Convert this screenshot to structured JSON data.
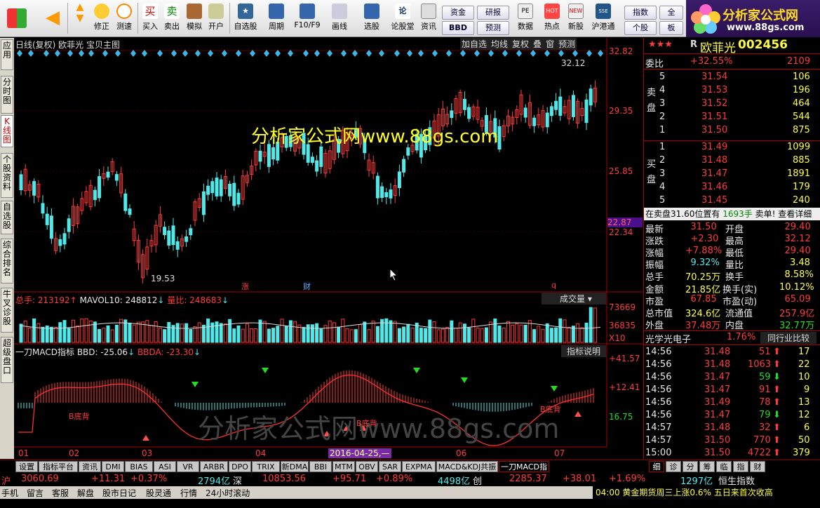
{
  "toolbar": {
    "buttons": [
      "修正",
      "测速",
      "买入",
      "卖出",
      "模拟",
      "开户",
      "自选股",
      "周期",
      "F10/F9",
      "画线",
      "选股",
      "论股堂",
      "资讯",
      "数据",
      "热点",
      "新股",
      "沪港通"
    ],
    "grid_buttons": [
      "资金",
      "研报",
      "指数",
      "全",
      "BBD",
      "预测",
      "个股",
      "板"
    ],
    "logo_main": "分析家公式网",
    "logo_url": "www.88gs.com"
  },
  "leftnav": [
    "应用",
    "分时图",
    "K线图",
    "个股资料",
    "自选股",
    "综合排名",
    "牛叉诊股",
    "超级盘口"
  ],
  "chart": {
    "header": "日线(复权) 欧菲光 宝贝主图",
    "header_btns": [
      "加自选",
      "均线",
      "复权",
      "叠",
      "窗",
      "预测"
    ],
    "watermark_top": "分析家公式网www.88gs.com",
    "watermark_bottom": "分析家公式网www.88gs.com",
    "price_axis": [
      "32.82",
      "29.35",
      "25.85",
      "22.34"
    ],
    "current_price_tag": "22.87",
    "high_label": "32.12",
    "low_label": "19.53",
    "markers": [
      "涨",
      "财",
      "q"
    ],
    "vol_header": {
      "total": "总手: 213192",
      "mavol": "MAVOL10: 248812",
      "ratio": "量比: 248683"
    },
    "vol_select": "成交量",
    "vol_axis": [
      "73669",
      "36835",
      "X10"
    ],
    "macd_header": {
      "name": "一刀MACD指标",
      "bbd": "BBD: -25.06",
      "bbda": "BBDA: -23.30"
    },
    "macd_btn": "指标说明",
    "macd_axis": [
      "+41.57",
      "+12.41",
      "16.75"
    ],
    "macd_labels": [
      "B底背",
      "B底背",
      "B底背"
    ],
    "date_axis": [
      "01",
      "02",
      "03",
      "04",
      "06",
      "07"
    ],
    "date_cursor": "2016-04-25,—"
  },
  "stock": {
    "stars": "★★★",
    "flag": "R",
    "name": "欧菲光",
    "code": "002456",
    "wei_label": "委比",
    "wei_pct": "+32.55%",
    "wei_val": "2109",
    "sell_label": "卖盘",
    "buy_label": "买盘",
    "sells": [
      {
        "n": "5",
        "p": "31.54",
        "v": "106"
      },
      {
        "n": "4",
        "p": "31.53",
        "v": "196"
      },
      {
        "n": "3",
        "p": "31.52",
        "v": "464"
      },
      {
        "n": "2",
        "p": "31.51",
        "v": "544"
      },
      {
        "n": "1",
        "p": "31.50",
        "v": "875"
      }
    ],
    "buys": [
      {
        "n": "1",
        "p": "31.49",
        "v": "1099"
      },
      {
        "n": "2",
        "p": "31.48",
        "v": "885"
      },
      {
        "n": "3",
        "p": "31.47",
        "v": "1891"
      },
      {
        "n": "4",
        "p": "31.46",
        "v": "179"
      },
      {
        "n": "5",
        "p": "31.45",
        "v": "240"
      }
    ],
    "notice_a": "在卖盘31.60位置有",
    "notice_b": "1693手",
    "notice_c": "卖单! 查看详细",
    "quotes": [
      [
        "最新",
        "31.50",
        "开盘",
        "29.40"
      ],
      [
        "涨跌",
        "+2.30",
        "最高",
        "32.12"
      ],
      [
        "涨幅",
        "+7.88%",
        "最低",
        "29.40"
      ],
      [
        "振幅",
        "9.32%",
        "量比",
        "3.48"
      ],
      [
        "总手",
        "70.25万",
        "换手",
        "8.58%"
      ],
      [
        "金额",
        "21.85亿",
        "换手(实)",
        "10.12%"
      ],
      [
        "市盈",
        "67.85",
        "市盈(动)",
        "65.09"
      ],
      [
        "总市值",
        "324.6亿",
        "流通值",
        "257.9亿"
      ],
      [
        "外盘",
        "37.48万",
        "内盘",
        "32.77万"
      ]
    ],
    "sector": "光学光电子",
    "sector_pct": "1.76%",
    "sector_btn": "同行业比较",
    "ticks": [
      [
        "14:56",
        "31.48",
        "51",
        "17"
      ],
      [
        "14:56",
        "31.48",
        "1063",
        "22"
      ],
      [
        "14:56",
        "31.47",
        "59",
        "10"
      ],
      [
        "14:56",
        "31.47",
        "91",
        "9"
      ],
      [
        "14:56",
        "31.49",
        "78",
        "13"
      ],
      [
        "14:56",
        "31.47",
        "79",
        "12"
      ],
      [
        "14:57",
        "31.48",
        "32",
        "6"
      ],
      [
        "14:57",
        "31.50",
        "770",
        "50"
      ],
      [
        "15:00",
        "31.50",
        "4722",
        "379"
      ]
    ],
    "rtabs": [
      "细",
      "诊",
      "分",
      "筹",
      "临",
      "指",
      "财"
    ]
  },
  "bottomtabs": [
    "设置",
    "指标平台",
    "资讯",
    "DMI",
    "BIAS",
    "ASI",
    "VR",
    "ARBR",
    "DPO",
    "TRIX",
    "新DMA",
    "BBI",
    "MTM",
    "OBV",
    "SAR",
    "EXPMA",
    "MACD&KDJ共振",
    "一刀MACD指标"
  ],
  "status": {
    "sh": "沪",
    "sh_idx": "3060.69",
    "sh_chg": "+11.31",
    "sh_pct": "+0.37%",
    "sh_amt": "2794亿",
    "sz": "深",
    "sz_idx": "10853.56",
    "sz_chg": "+95.71",
    "sz_pct": "+0.89%",
    "sz_amt": "4498亿",
    "cy": "创",
    "cy_idx": "2285.37",
    "cy_chg": "+38.01",
    "cy_pct": "+1.69%",
    "cy_amt": "1297亿",
    "hs": "恒生指数"
  },
  "bottombar": [
    "手机",
    "留言",
    "客服",
    "解盘",
    "股市日记",
    "股灵通",
    "行情",
    "24小时滚动"
  ],
  "ticker": "04:00 黄金期货周三上涨0.6% 五日来首次收高"
}
